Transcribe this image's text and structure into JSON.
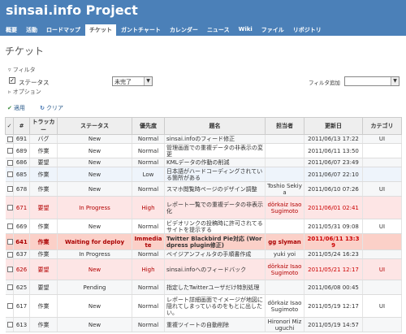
{
  "header": {
    "title": "sinsai.info Project",
    "menu": [
      {
        "label": "概要",
        "selected": false
      },
      {
        "label": "活動",
        "selected": false
      },
      {
        "label": "ロードマップ",
        "selected": false
      },
      {
        "label": "チケット",
        "selected": true
      },
      {
        "label": "ガントチャート",
        "selected": false
      },
      {
        "label": "カレンダー",
        "selected": false
      },
      {
        "label": "ニュース",
        "selected": false
      },
      {
        "label": "Wiki",
        "selected": false
      },
      {
        "label": "ファイル",
        "selected": false
      },
      {
        "label": "リポジトリ",
        "selected": false
      }
    ]
  },
  "page_title": "チケット",
  "filters": {
    "legend": "フィルタ",
    "status_label": "ステータス",
    "status_value": "未完了",
    "add_filter_label": "フィルタ追加",
    "add_filter_value": "",
    "options_legend": "オプション"
  },
  "actions": {
    "apply": "適用",
    "clear": "クリア"
  },
  "table": {
    "headers": {
      "id": "#",
      "tracker": "トラッカー",
      "status": "ステータス",
      "priority": "優先度",
      "subject": "題名",
      "assignee": "担当者",
      "updated": "更新日",
      "category": "カテゴリ"
    },
    "rows": [
      {
        "id": "691",
        "tracker": "バグ",
        "status": "New",
        "priority": "Normal",
        "subject": "sinsai.infoのフィード修正",
        "assignee": "",
        "updated": "2011/06/13 17:22",
        "category": "UI",
        "style": "odd",
        "h": 10
      },
      {
        "id": "689",
        "tracker": "作業",
        "status": "New",
        "priority": "Normal",
        "subject": "管理画面での重複データの非表示の変更",
        "assignee": "",
        "updated": "2011/06/11 13:50",
        "category": "",
        "style": "even",
        "h": 18
      },
      {
        "id": "686",
        "tracker": "要望",
        "status": "New",
        "priority": "Normal",
        "subject": "KMLデータの作動の削減",
        "assignee": "",
        "updated": "2011/06/07 23:49",
        "category": "",
        "style": "odd",
        "h": 10
      },
      {
        "id": "685",
        "tracker": "作業",
        "status": "New",
        "priority": "Low",
        "subject": "日本語がハードコーディングされている箇所がある",
        "assignee": "",
        "updated": "2011/06/07 22:10",
        "category": "",
        "style": "lowp",
        "h": 18
      },
      {
        "id": "678",
        "tracker": "作業",
        "status": "New",
        "priority": "Normal",
        "subject": "スマホ閲覧時ページのデザイン調整",
        "assignee": "Toshio Sekiya",
        "updated": "2011/06/10 07:26",
        "category": "UI",
        "style": "odd",
        "h": 18
      },
      {
        "id": "671",
        "tracker": "要望",
        "status": "In Progress",
        "priority": "High",
        "subject": "レポート一覧での重複データの非表示化",
        "assignee": "dörkaiz Isao Sugimoto",
        "updated": "2011/06/01 02:41",
        "category": "",
        "style": "hi",
        "h": 28
      },
      {
        "id": "669",
        "tracker": "作業",
        "status": "New",
        "priority": "Normal",
        "subject": "ビデオリンクの投稿時に許可されてるサイトを提示する",
        "assignee": "",
        "updated": "2011/05/31 09:08",
        "category": "UI",
        "style": "even",
        "h": 18
      },
      {
        "id": "641",
        "tracker": "作業",
        "status": "Waiting for deploy",
        "priority": "Immediate",
        "subject": "Twitter Blackbird Pie対応 (Wordpress plugin修正)",
        "assignee": "gg slyman",
        "updated": "2011/06/11 13:39",
        "category": "",
        "style": "urgent",
        "h": 20
      },
      {
        "id": "637",
        "tracker": "作業",
        "status": "In Progress",
        "priority": "Normal",
        "subject": "ベイジアンフィルタの手順書作成",
        "assignee": "yuki yoi",
        "updated": "2011/05/24 16:23",
        "category": "",
        "style": "odd",
        "h": 10
      },
      {
        "id": "626",
        "tracker": "要望",
        "status": "New",
        "priority": "High",
        "subject": "sinsai.infoへのフィードバック",
        "assignee": "dörkaiz Isao Sugimoto",
        "updated": "2011/05/21 12:17",
        "category": "UI",
        "style": "hi",
        "h": 26
      },
      {
        "id": "625",
        "tracker": "要望",
        "status": "Pending",
        "priority": "Normal",
        "subject": "指定したTwitterユーザだけ特別処理",
        "assignee": "",
        "updated": "2011/06/08 00:45",
        "category": "",
        "style": "odd",
        "h": 18
      },
      {
        "id": "617",
        "tracker": "作業",
        "status": "New",
        "priority": "Normal",
        "subject": "レポート詳細画面でイメージが地図に隠れてしまっているのをもとに出したい。",
        "assignee": "dörkaiz Isao Sugimoto",
        "updated": "2011/05/19 12:17",
        "category": "UI",
        "style": "even",
        "h": 28
      },
      {
        "id": "613",
        "tracker": "作業",
        "status": "New",
        "priority": "Normal",
        "subject": "重複ツイートの自動削除",
        "assignee": "Hironori Mizuguchi",
        "updated": "2011/05/19 14:57",
        "category": "",
        "style": "odd",
        "h": 18
      }
    ]
  }
}
